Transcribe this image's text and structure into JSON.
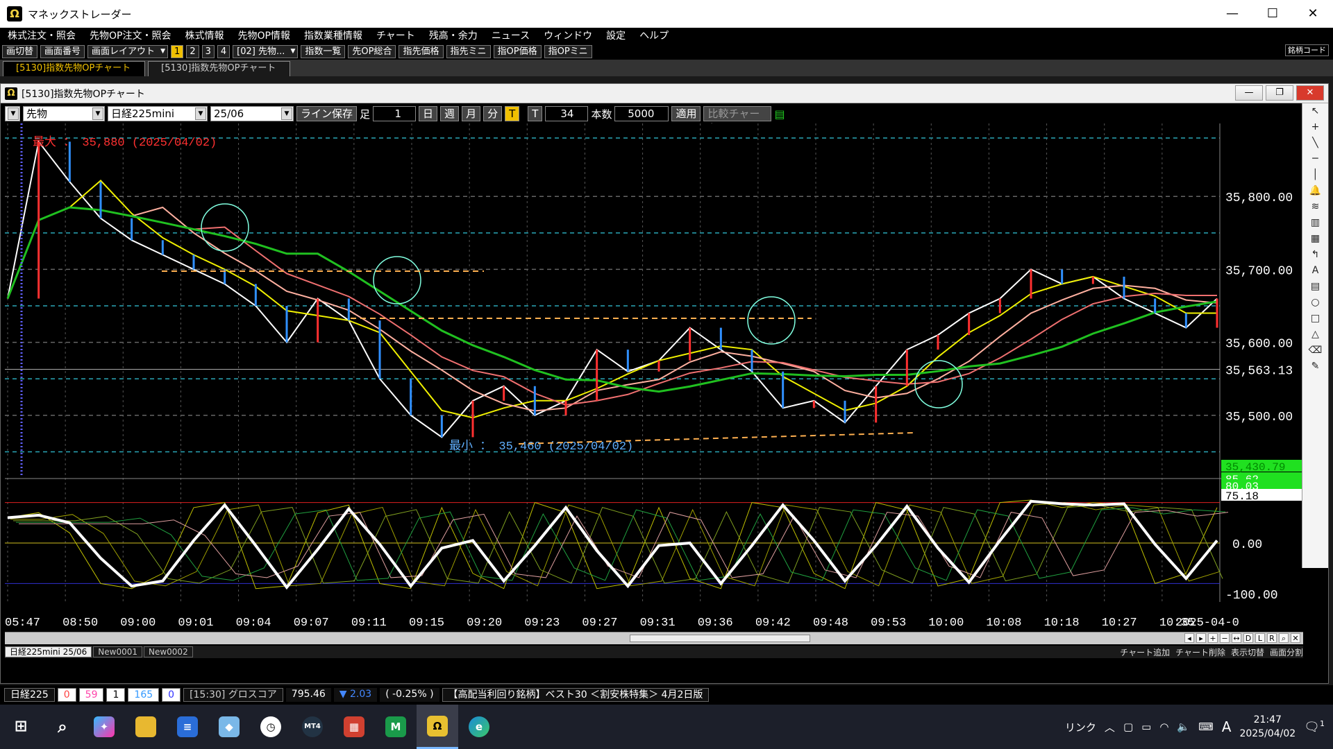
{
  "window": {
    "title": "マネックストレーダー",
    "minimize": "—",
    "maximize": "☐",
    "close": "✕"
  },
  "menu": [
    "株式注文・照会",
    "先物OP注文・照会",
    "株式情報",
    "先物OP情報",
    "指数業種情報",
    "チャート",
    "残高・余力",
    "ニュース",
    "ウィンドウ",
    "設定",
    "ヘルプ"
  ],
  "toolbar": {
    "switch": "画切替",
    "screen_num": "画面番号",
    "layout": "画面レイアウト",
    "pages": [
      "1",
      "2",
      "3",
      "4"
    ],
    "active_page": "1",
    "preset": "[02] 先物...",
    "buttons": [
      "指数一覧",
      "先OP総合",
      "指先価格",
      "指先ミニ",
      "指OP価格",
      "指OPミニ"
    ],
    "code_label": "銘柄コード"
  },
  "tabs": [
    "[5130]指数先物OPチャート",
    "[5130]指数先物OPチャート"
  ],
  "subwindow": {
    "title": "[5130]指数先物OPチャート"
  },
  "controls": {
    "type": "先物",
    "index": "日経225mini",
    "contract": "25/06",
    "line_save": "ライン保存",
    "ashi_label": "足",
    "ashi_value": "1",
    "periods": [
      "日",
      "週",
      "月",
      "分",
      "T"
    ],
    "active_period": "T",
    "t_label": "T",
    "t_value": "34",
    "count_label": "本数",
    "count_value": "5000",
    "apply": "適用",
    "compare": "比較チャート"
  },
  "chart_data": {
    "type": "line",
    "max_label": "最大 ： 35,880 (2025/04/02)",
    "min_label": "最小 ： 35,460 (2025/04/02)",
    "price_axis": [
      "35,800.00",
      "35,700.00",
      "35,600.00",
      "35,500.00"
    ],
    "current_price": "35,563.13",
    "ylim": [
      35420,
      35900
    ],
    "osc_axis": [
      "0.00",
      "-100.00"
    ],
    "osc_tags": [
      "35,430.79",
      "85.62",
      "80.03",
      "75.18"
    ],
    "x": [
      "05:47",
      "08:50",
      "09:00",
      "09:01",
      "09:04",
      "09:07",
      "09:11",
      "09:15",
      "09:20",
      "09:23",
      "09:27",
      "09:31",
      "09:36",
      "09:42",
      "09:48",
      "09:53",
      "10:00",
      "10:08",
      "10:18",
      "10:27",
      "10:35",
      "2025-04-0"
    ],
    "close": [
      35660,
      35875,
      35820,
      35770,
      35740,
      35720,
      35700,
      35680,
      35650,
      35600,
      35660,
      35630,
      35550,
      35500,
      35470,
      35520,
      35540,
      35500,
      35520,
      35590,
      35560,
      35575,
      35620,
      35590,
      35560,
      35510,
      35520,
      35490,
      35540,
      35590,
      35610,
      35640,
      35660,
      35700,
      35680,
      35690,
      35660,
      35640,
      35620,
      35660
    ],
    "series_colors": [
      "#ffffff",
      "#f0f000",
      "#ffb0a0",
      "#f07070",
      "#20c020"
    ],
    "osc": [
      50,
      60,
      20,
      -80,
      -90,
      -60,
      70,
      80,
      -90,
      -85,
      60,
      75,
      -80,
      -90,
      70,
      -60,
      -90,
      80,
      60,
      -90,
      -80,
      70,
      -70,
      -90,
      80,
      70,
      -60,
      -90,
      80,
      65,
      -85,
      -70,
      80,
      85,
      70,
      80,
      75,
      -80,
      -60,
      70
    ],
    "grid": true
  },
  "chart_tabs": [
    "日経225mini 25/06",
    "New0001",
    "New0002"
  ],
  "chart_tabs_right": [
    "チャート追加",
    "チャート削除",
    "表示切替",
    "画面分割"
  ],
  "ticker": {
    "label": "日経225",
    "v1": "0",
    "v2": "59",
    "v3": "1",
    "v4": "165",
    "v5": "0",
    "growth": "[15:30] グロスコア",
    "growth_price": "795.46",
    "growth_chg": "▼ 2.03",
    "growth_pct": "( -0.25% )",
    "news": "【高配当利回り銘柄】ベスト30 ＜割安株特集＞ 4月2日版"
  },
  "taskbar": {
    "ime": "A",
    "link": "リンク",
    "time": "21:47",
    "date": "2025/04/02",
    "notify": "1"
  }
}
